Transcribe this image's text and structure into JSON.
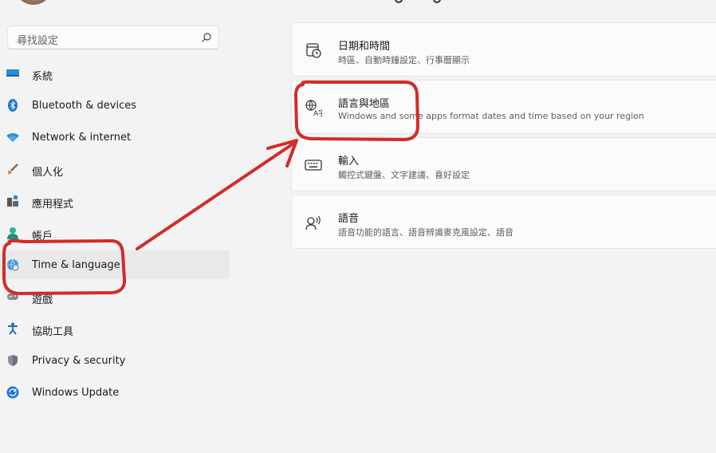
{
  "search": {
    "placeholder": "尋找設定"
  },
  "nav": [
    {
      "label": "系統",
      "icon": "monitor-icon"
    },
    {
      "label": "Bluetooth & devices",
      "icon": "bluetooth-icon"
    },
    {
      "label": "Network & internet",
      "icon": "wifi-icon"
    },
    {
      "label": "個人化",
      "icon": "paintbrush-icon"
    },
    {
      "label": "應用程式",
      "icon": "apps-icon"
    },
    {
      "label": "帳戶",
      "icon": "person-icon"
    },
    {
      "label": "Time & language",
      "icon": "globe-clock-icon",
      "active": true
    },
    {
      "label": "遊戲",
      "icon": "gamepad-icon"
    },
    {
      "label": "協助工具",
      "icon": "accessibility-icon"
    },
    {
      "label": "Privacy & security",
      "icon": "shield-icon"
    },
    {
      "label": "Windows Update",
      "icon": "update-icon"
    }
  ],
  "cards": [
    {
      "title": "日期和時間",
      "desc": "時區、自動時鐘設定、行事曆顯示",
      "icon": "calendar-clock-icon"
    },
    {
      "title": "語言與地區",
      "desc": "Windows and some apps format dates and time based on your region",
      "icon": "language-icon"
    },
    {
      "title": "輸入",
      "desc": "觸控式鍵盤、文字建議、喜好設定",
      "icon": "keyboard-icon"
    },
    {
      "title": "語音",
      "desc": "語音功能的語言、語音辨識麥克風設定、語音",
      "icon": "speech-icon"
    }
  ],
  "colors": {
    "annotation": "#d42a2a",
    "accent": "#0067c0"
  }
}
